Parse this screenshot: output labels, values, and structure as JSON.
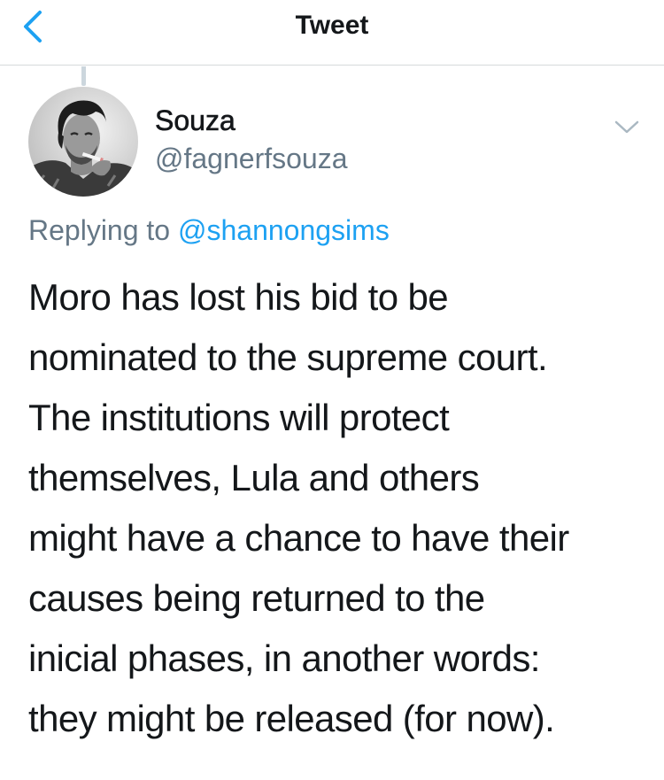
{
  "nav": {
    "back_icon": "chevron-left-icon",
    "title": "Tweet"
  },
  "author": {
    "display_name": "Souza",
    "username": "@fagnerfsouza",
    "avatar": "profile-photo",
    "menu_icon": "chevron-down-icon"
  },
  "reply": {
    "prefix": "Replying to",
    "handle": "@shannongsims"
  },
  "tweet": {
    "lines": [
      "Moro has lost his bid to be",
      "nominated to the supreme court.",
      "The institutions will protect",
      "themselves, Lula and others",
      "might have a chance to have their",
      "causes being returned to the",
      "inicial phases, in another words:",
      "they might be released (for now)."
    ]
  },
  "colors": {
    "accent": "#1da1f2",
    "secondary_text": "#657786",
    "primary_text": "#14171a",
    "divider": "#d6d9db"
  }
}
